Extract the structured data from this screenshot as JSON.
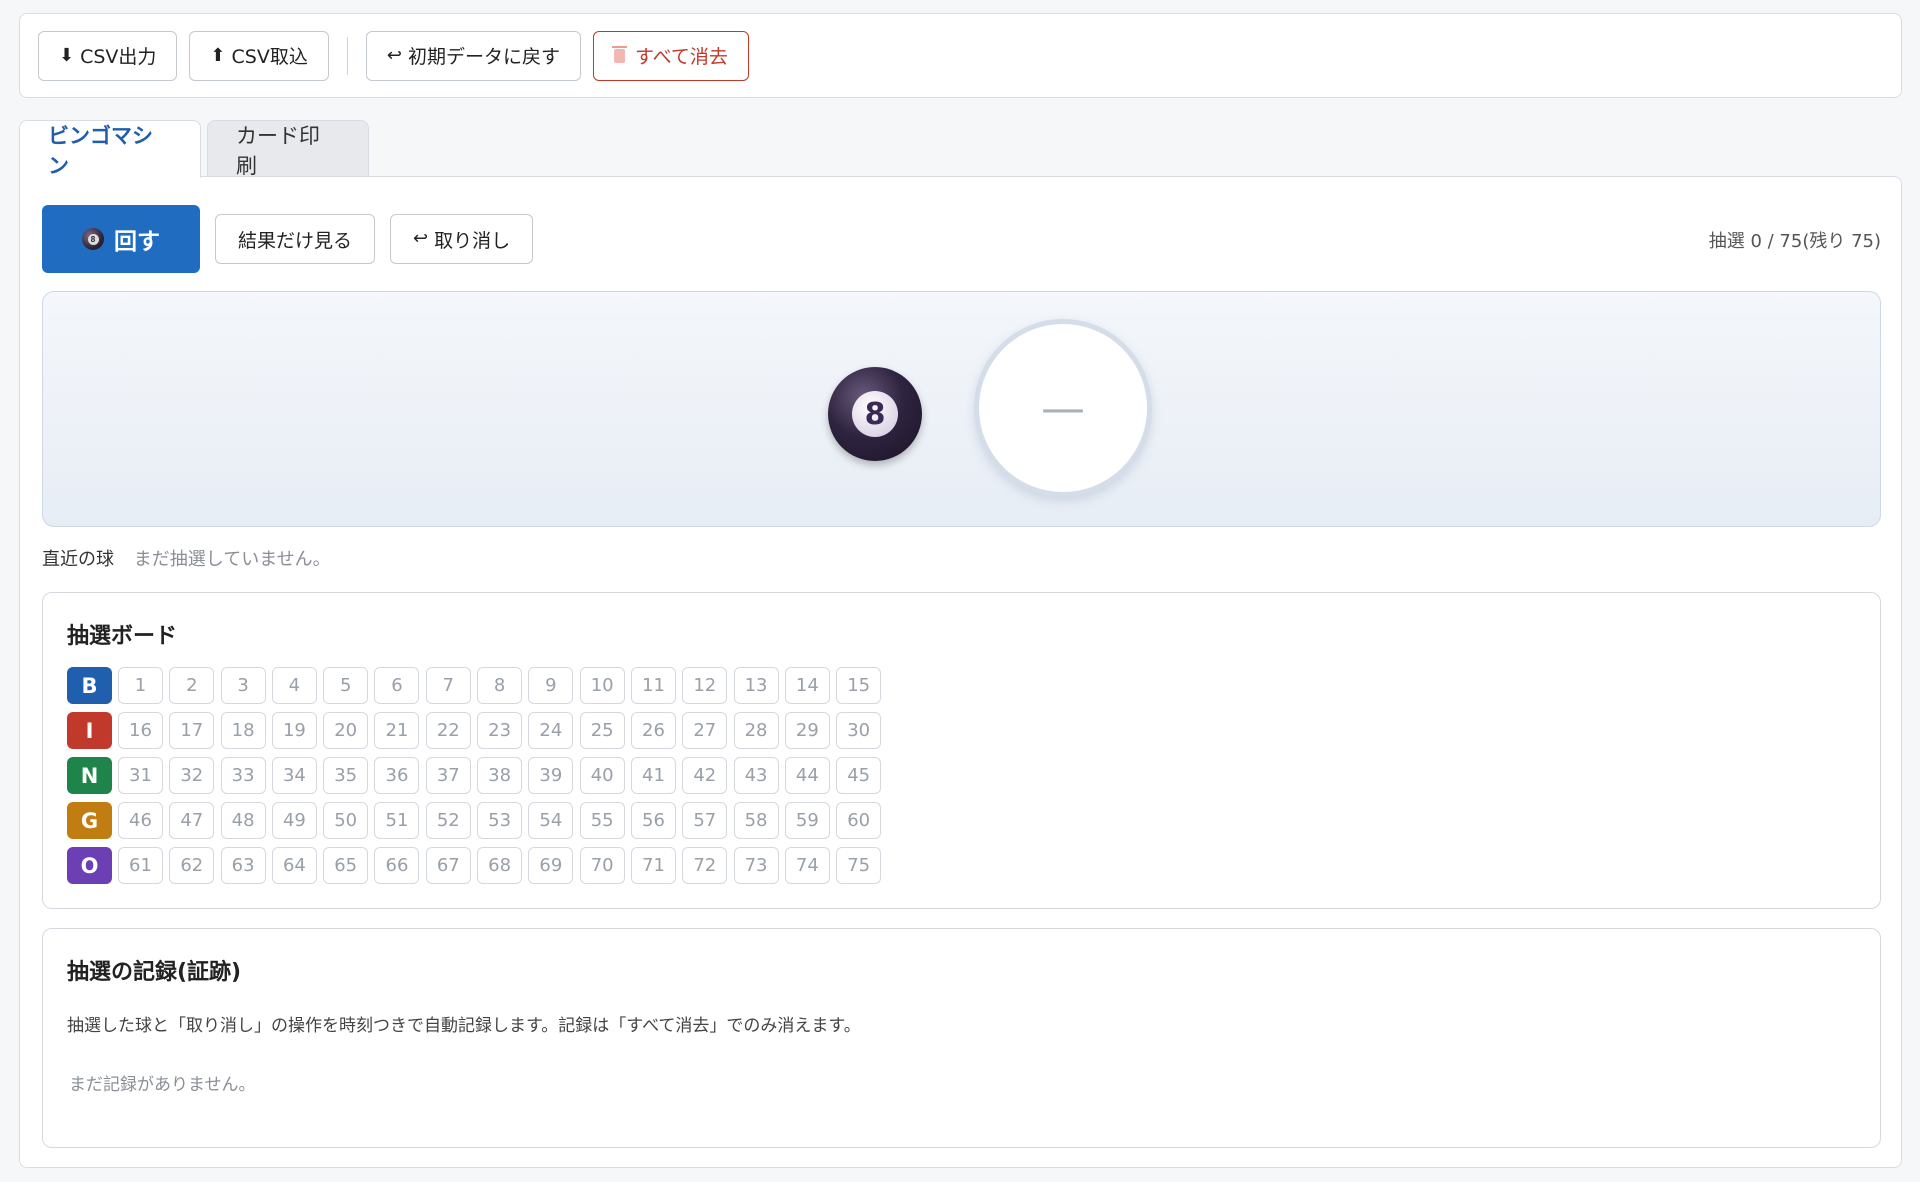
{
  "toolbar": {
    "csv_export": "CSV出力",
    "csv_import": "CSV取込",
    "reset_initial": "初期データに戻す",
    "clear_all": "すべて消去"
  },
  "tabs": [
    {
      "label": "ビンゴマシン",
      "active": true
    },
    {
      "label": "カード印刷",
      "active": false
    }
  ],
  "controls": {
    "spin": "回す",
    "result_only": "結果だけ見る",
    "undo": "取り消し",
    "counter": "抽選 0 / 75(残り 75)"
  },
  "stage": {
    "ball_number": "8",
    "result": "—"
  },
  "recent": {
    "label": "直近の球",
    "value": "まだ抽選していません。"
  },
  "board": {
    "title": "抽選ボード",
    "rows": [
      {
        "letter": "B",
        "color": "#1f5fae",
        "numbers": [
          "1",
          "2",
          "3",
          "4",
          "5",
          "6",
          "7",
          "8",
          "9",
          "10",
          "11",
          "12",
          "13",
          "14",
          "15"
        ]
      },
      {
        "letter": "I",
        "color": "#c0392b",
        "numbers": [
          "16",
          "17",
          "18",
          "19",
          "20",
          "21",
          "22",
          "23",
          "24",
          "25",
          "26",
          "27",
          "28",
          "29",
          "30"
        ]
      },
      {
        "letter": "N",
        "color": "#1e8449",
        "numbers": [
          "31",
          "32",
          "33",
          "34",
          "35",
          "36",
          "37",
          "38",
          "39",
          "40",
          "41",
          "42",
          "43",
          "44",
          "45"
        ]
      },
      {
        "letter": "G",
        "color": "#c17d11",
        "numbers": [
          "46",
          "47",
          "48",
          "49",
          "50",
          "51",
          "52",
          "53",
          "54",
          "55",
          "56",
          "57",
          "58",
          "59",
          "60"
        ]
      },
      {
        "letter": "O",
        "color": "#6c3fb5",
        "numbers": [
          "61",
          "62",
          "63",
          "64",
          "65",
          "66",
          "67",
          "68",
          "69",
          "70",
          "71",
          "72",
          "73",
          "74",
          "75"
        ]
      }
    ]
  },
  "log": {
    "title": "抽選の記録(証跡)",
    "description": "抽選した球と「取り消し」の操作を時刻つきで自動記録します。記録は「すべて消去」でのみ消えます。",
    "empty": "まだ記録がありません。"
  }
}
